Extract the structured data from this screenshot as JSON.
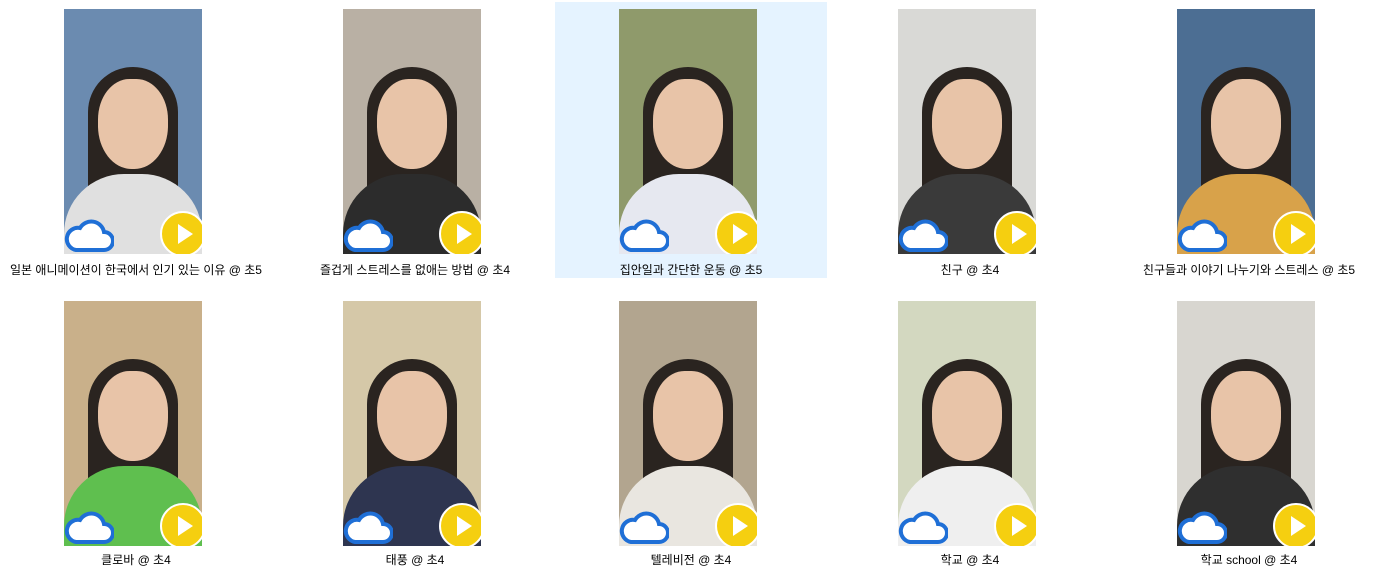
{
  "items": [
    {
      "title": "일본 애니메이션이 한국에서 인기 있는 이유 @ 초5",
      "bg": "#6b8bb0",
      "shirt": "#e0e0e0",
      "selected": false
    },
    {
      "title": "즐겁게 스트레스를 없애는 방법 @ 초4",
      "bg": "#b9b0a4",
      "shirt": "#2c2c2c",
      "selected": false
    },
    {
      "title": "집안일과 간단한 운동 @ 초5",
      "bg": "#8f9a6b",
      "shirt": "#e6e8f0",
      "selected": true
    },
    {
      "title": "친구 @ 초4",
      "bg": "#d9d9d6",
      "shirt": "#3a3a3a",
      "selected": false
    },
    {
      "title": "친구들과 이야기 나누기와 스트레스 @ 초5",
      "bg": "#4c6e93",
      "shirt": "#d8a24a",
      "selected": false
    },
    {
      "title": "클로바 @ 초4",
      "bg": "#c9b08a",
      "shirt": "#5fbf4f",
      "selected": false
    },
    {
      "title": "태풍 @ 초4",
      "bg": "#d5c8a8",
      "shirt": "#2e3550",
      "selected": false
    },
    {
      "title": "텔레비전 @ 초4",
      "bg": "#b2a58f",
      "shirt": "#e9e6e0",
      "selected": false
    },
    {
      "title": "학교 @ 초4",
      "bg": "#d3d8c0",
      "shirt": "#efefef",
      "selected": false
    },
    {
      "title": "학교 school @ 초4",
      "bg": "#d8d6d0",
      "shirt": "#2f2f2f",
      "selected": false
    }
  ],
  "icons": {
    "cloud": "onedrive-cloud-icon",
    "play": "play-icon"
  },
  "colors": {
    "cloud_blue": "#1f6fd6",
    "play_yellow": "#f5cf10",
    "selection": "#e5f3ff"
  }
}
